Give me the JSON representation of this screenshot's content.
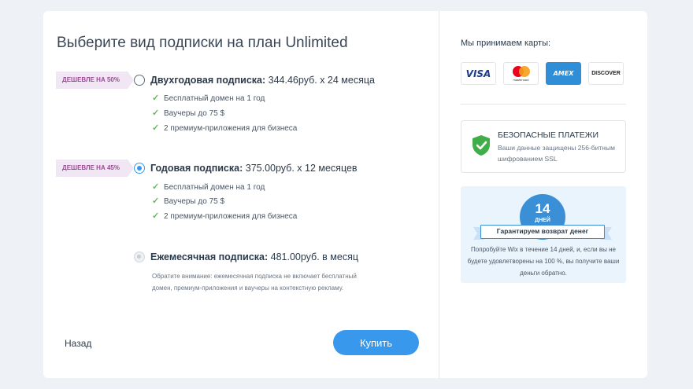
{
  "title": "Выберите вид подписки на план Unlimited",
  "plans": [
    {
      "ribbon": "ДЕШЕВЛЕ НА 50%",
      "name": "Двухгодовая подписка:",
      "price": "344.46руб. x 24 месяца",
      "selected": false,
      "features": [
        "Бесплатный домен на 1 год",
        "Ваучеры до 75 $",
        "2 премиум-приложения для бизнеса"
      ]
    },
    {
      "ribbon": "ДЕШЕВЛЕ НА 45%",
      "name": "Годовая подписка:",
      "price": "375.00руб. x 12 месяцев",
      "selected": true,
      "features": [
        "Бесплатный домен на 1 год",
        "Ваучеры до 75 $",
        "2 премиум-приложения для бизнеса"
      ]
    },
    {
      "name": "Ежемесячная подписка:",
      "price": "481.00руб. в месяц",
      "selected": false,
      "note": "Обратите внимание: ежемесячная подписка не включает бесплатный домен, премиум-приложения и ваучеры на контекстную рекламу."
    }
  ],
  "back_label": "Назад",
  "buy_label": "Купить",
  "accept_label": "Мы принимаем карты:",
  "cards": {
    "visa": "VISA",
    "mastercard": "mastercard",
    "amex": "AMEX",
    "discover": "DISCOVER"
  },
  "secure": {
    "title": "БЕЗОПАСНЫЕ ПЛАТЕЖИ",
    "desc": "Ваши данные защищены 256-битным шифрованием SSL"
  },
  "guarantee": {
    "days_num": "14",
    "days_word": "ДНЕЙ",
    "banner": "Гарантируем возврат денег",
    "text": "Попробуйте Wix в течение 14 дней, и, если вы не будете удовлетворены на 100 %, вы получите ваши деньги обратно."
  },
  "colors": {
    "accent": "#3899ec",
    "ribbon_bg": "#f1e6f3",
    "ribbon_text": "#a0479b",
    "check": "#60bc57",
    "shield": "#3fae49"
  },
  "icons": [
    "radio",
    "check-icon",
    "visa-icon",
    "mastercard-icon",
    "amex-icon",
    "discover-icon",
    "shield-check-icon"
  ]
}
